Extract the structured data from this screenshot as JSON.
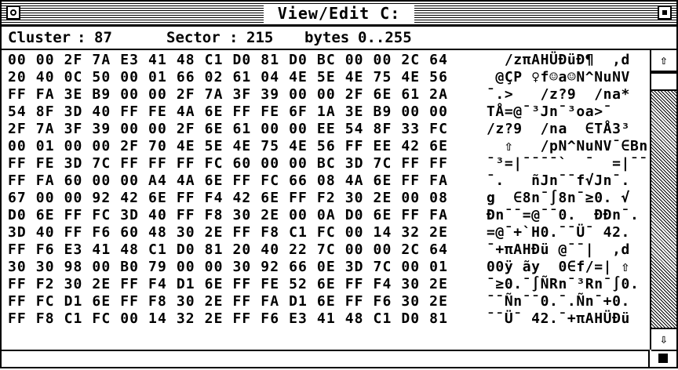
{
  "window": {
    "title": "View/Edit C:"
  },
  "info": {
    "cluster_label": "Cluster",
    "cluster_value": "87",
    "sector_label": "Sector",
    "sector_value": "215",
    "bytes_label": "bytes",
    "bytes_range": "0..255"
  },
  "hex_rows": [
    "00 00 2F 7A E3 41 48 C1 D0 81 D0 BC 00 00 2C 64",
    "20 40 0C 50 00 01 66 02 61 04 4E 5E 4E 75 4E 56",
    "FF FA 3E B9 00 00 2F 7A 3F 39 00 00 2F 6E 61 2A",
    "54 8F 3D 40 FF FE 4A 6E FF FE 6F 1A 3E B9 00 00",
    "2F 7A 3F 39 00 00 2F 6E 61 00 00 EE 54 8F 33 FC",
    "00 01 00 00 2F 70 4E 5E 4E 75 4E 56 FF EE 42 6E",
    "FF FE 3D 7C FF FF FF FC 60 00 00 BC 3D 7C FF FF",
    "FF FA 60 00 00 A4 4A 6E FF FC 66 08 4A 6E FF FA",
    "67 00 00 92 42 6E FF F4 42 6E FF F2 30 2E 00 08",
    "D0 6E FF FC 3D 40 FF F8 30 2E 00 0A D0 6E FF FA",
    "3D 40 FF F6 60 48 30 2E FF F8 C1 FC 00 14 32 2E",
    "FF F6 E3 41 48 C1 D0 81 20 40 22 7C 00 00 2C 64",
    "30 30 98 00 B0 79 00 00 30 92 66 0E 3D 7C 00 01",
    "FF F2 30 2E FF F4 D1 6E FF FE 52 6E FF F4 30 2E",
    "FF FC D1 6E FF F8 30 2E FF FA D1 6E FF F6 30 2E",
    "FF F8 C1 FC 00 14 32 2E FF F6 E3 41 48 C1 D0 81"
  ],
  "ascii_rows": [
    "  /zπAHÜÐüÐ¶  ,d",
    " @ÇP ♀f☺a☺N^NuNV",
    "¯.>   /z?9  /na*",
    "TÅ=@¯³Jn¯³oa>¯",
    "/z?9  /na  ∈TÅ3³",
    "  ⇧   /pN^NuNV¯∈Bn",
    "¯³=|¯¯¯¯`  ¯  =|¯¯",
    "¯.   ñJn¯¯f√Jn¯.",
    "g  ∈8n¯∫8n¯≥0. √",
    "Ðn¯¯=@¯¯0.  ÐÐn¯.",
    "=@¯+`H0.¯¯Ü¯ 42.",
    "¯+πAHÐü @¯¯|  ,d",
    "00ÿ ãy  0∈f/=| ⇧",
    "¯≥0.¯∫ÑRn¯³Rn¯∫0.",
    "¯¯Ñn¯¯0.¯.Ñn¯+0.",
    "¯¯Ü¯ 42.¯+πAHÜÐü"
  ],
  "scroll": {
    "up_icon": "⇧",
    "down_icon": "⇩",
    "position": 0.0
  }
}
